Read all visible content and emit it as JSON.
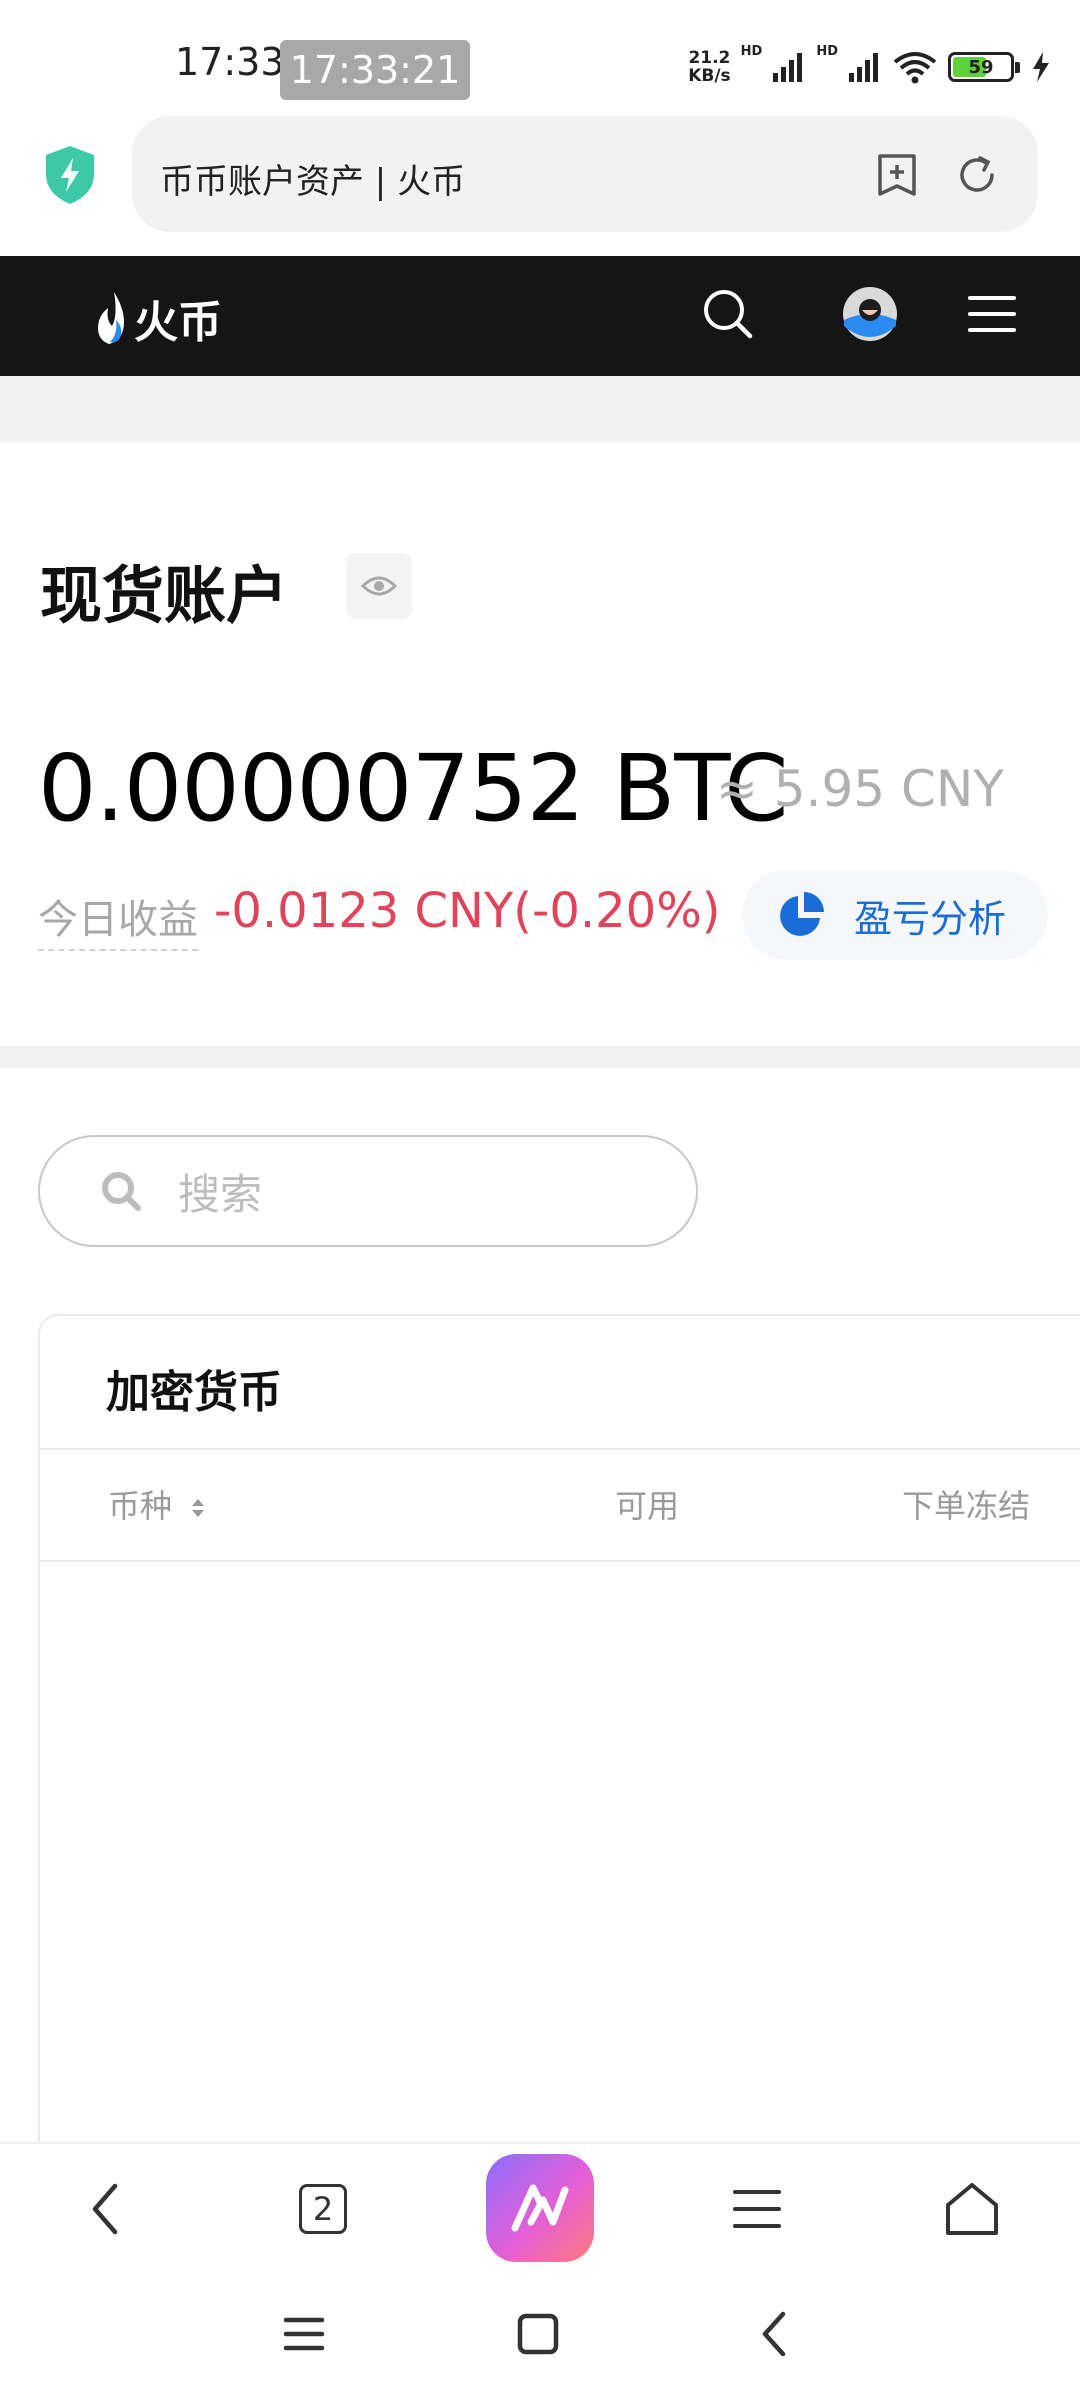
{
  "status_bar": {
    "time": "17:33",
    "clock_overlay": "17:33:21",
    "net_speed_value": "21.2",
    "net_speed_unit": "KB/s",
    "hd1": "HD",
    "hd2": "HD",
    "battery": "59",
    "icons": [
      "signal-icon",
      "wifi-icon",
      "battery-icon",
      "charging-icon"
    ]
  },
  "browser": {
    "url_title": "币币账户资产 | 火币",
    "icons": [
      "shield-icon",
      "add-bookmark-icon",
      "refresh-icon"
    ]
  },
  "site_header": {
    "logo_text": "火币",
    "icons": [
      "search-icon",
      "avatar",
      "menu-icon"
    ]
  },
  "account": {
    "title": "现货账户",
    "balance": "0.00000752 BTC",
    "approx_value": "≈ 5.95 CNY",
    "pnl_label": "今日收益",
    "pnl_value": "-0.0123 CNY(-0.20%)",
    "analysis_button": "盈亏分析",
    "colors": {
      "loss": "#e0445a",
      "accent": "#1a6dd6"
    }
  },
  "search": {
    "placeholder": "搜索"
  },
  "crypto_table": {
    "title": "加密货币",
    "columns": [
      "币种",
      "可用",
      "下单冻结"
    ],
    "rows": []
  },
  "bottom_nav": {
    "tab_count": "2",
    "icons": [
      "back-icon",
      "tabs-icon",
      "ai-assistant-icon",
      "menu-icon",
      "home-icon"
    ]
  },
  "system_nav": {
    "icons": [
      "recents-icon",
      "home-icon",
      "back-icon"
    ]
  }
}
